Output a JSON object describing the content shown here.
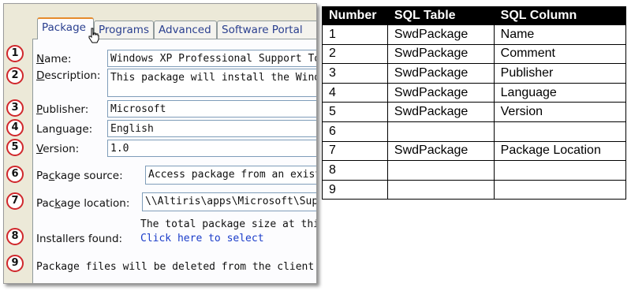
{
  "tabs": [
    {
      "label": "Package",
      "active": true
    },
    {
      "label": "Programs"
    },
    {
      "label": "Advanced"
    },
    {
      "label": "Software Portal"
    }
  ],
  "form": {
    "name_label_pre": "",
    "name_label_key": "N",
    "name_label_post": "ame:",
    "name_value": "Windows XP Professional Support Too",
    "description_label_pre": "",
    "description_label_key": "D",
    "description_label_post": "escription:",
    "description_value": "This package will install the Windows",
    "publisher_label_pre": "",
    "publisher_label_key": "P",
    "publisher_label_post": "ublisher:",
    "publisher_value": "Microsoft",
    "language_label_pre": "Lan",
    "language_label_key": "g",
    "language_label_post": "uage:",
    "language_value": "English",
    "version_label_pre": "",
    "version_label_key": "V",
    "version_label_post": "ersion:",
    "version_value": "1.0",
    "source_label_pre": "Pa",
    "source_label_key": "c",
    "source_label_post": "kage source:",
    "source_value": "Access package from an existi",
    "location_label_pre": "Pac",
    "location_label_key": "k",
    "location_label_post": "age location:",
    "location_value": "\\\\Altiris\\apps\\Microsoft\\Suppor",
    "size_text": "The total package size at this lo",
    "installers_label": "Installers found:",
    "installers_link": "Click here to select",
    "delete_text": "Package files will be deleted from the client compu"
  },
  "badges": [
    "1",
    "2",
    "3",
    "4",
    "5",
    "6",
    "7",
    "8",
    "9"
  ],
  "table": {
    "headers": [
      "Number",
      "SQL Table",
      "SQL Column"
    ],
    "rows": [
      [
        "1",
        "SwdPackage",
        "Name"
      ],
      [
        "2",
        "SwdPackage",
        "Comment"
      ],
      [
        "3",
        "SwdPackage",
        "Publisher"
      ],
      [
        "4",
        "SwdPackage",
        "Language"
      ],
      [
        "5",
        "SwdPackage",
        "Version"
      ],
      [
        "6",
        "",
        ""
      ],
      [
        "7",
        "SwdPackage",
        "Package Location"
      ],
      [
        "8",
        "",
        ""
      ],
      [
        "9",
        "",
        ""
      ]
    ]
  },
  "colors": {
    "badge_border": "#d0272c",
    "active_tab_accent": "#e68b2c",
    "link": "#1a3cc9"
  }
}
